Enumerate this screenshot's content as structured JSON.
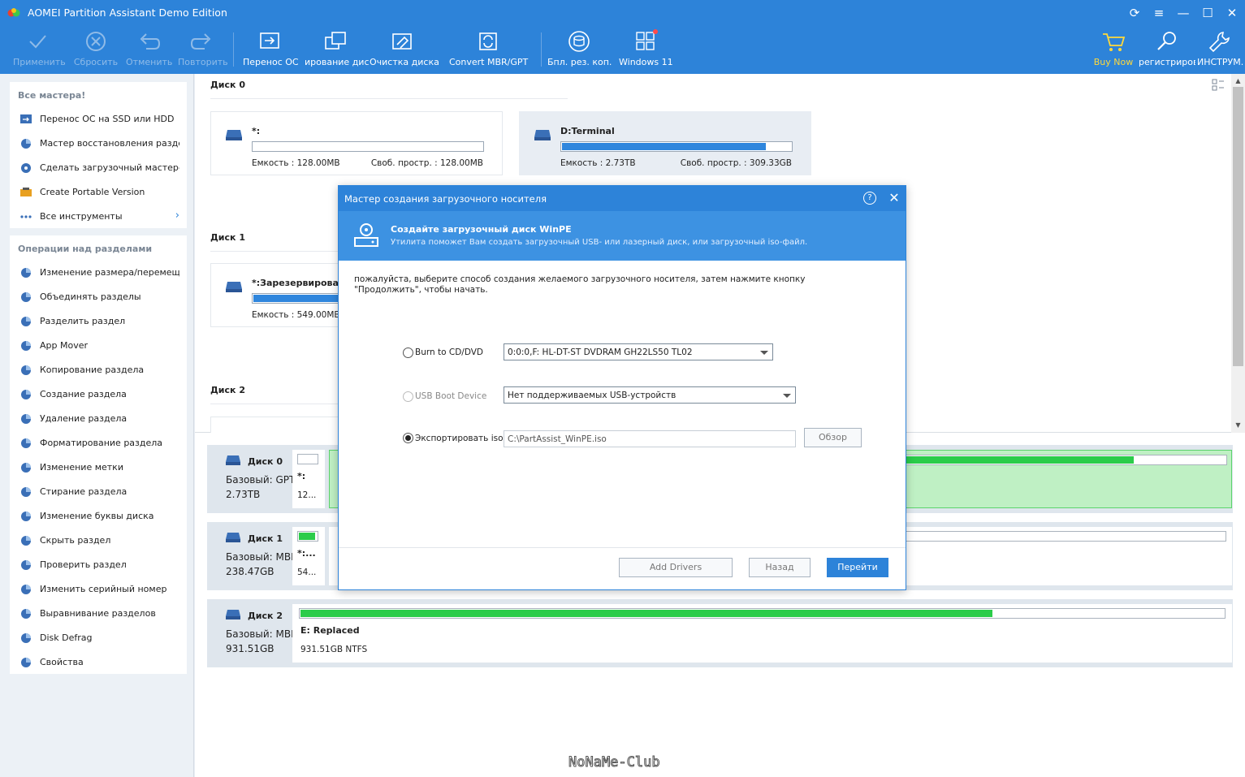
{
  "app": {
    "title": "AOMEI Partition Assistant Demo Edition"
  },
  "toolbar": {
    "apply": "Применить",
    "reset": "Сбросить",
    "undo": "Отменить",
    "redo": "Повторить",
    "migrate_os": "Перенос ОС",
    "clone_disk": "ирование дис",
    "wipe_disk": "Очистка диска",
    "convert": "Convert MBR/GPT",
    "backup": "Бпл. рез. коп.",
    "windows11": "Windows 11",
    "buy_now": "Buy Now",
    "register": "регистрирова",
    "tools": "ИНСТРУМ."
  },
  "sidebar": {
    "wizards_heading": "Все мастера!",
    "wizards": [
      "Перенос ОС на SSD или HDD",
      "Мастер восстановления раздела",
      "Сделать загрузочный мастер-...",
      "Create Portable Version",
      "Все инструменты"
    ],
    "ops_heading": "Операции над разделами",
    "ops": [
      "Изменение размера/перемеще...",
      "Объединять разделы",
      "Разделить раздел",
      "App Mover",
      "Копирование раздела",
      "Создание раздела",
      "Удаление раздела",
      "Форматирование раздела",
      "Изменение метки",
      "Стирание раздела",
      "Изменение буквы диска",
      "Скрыть раздел",
      "Проверить раздел",
      "Изменить серийный номер",
      "Выравнивание разделов",
      "Disk Defrag",
      "Свойства"
    ]
  },
  "upper": {
    "disk0_title": "Диск 0",
    "disk1_title": "Диск 1",
    "disk2_title": "Диск 2",
    "p0a": {
      "name": "*:",
      "cap": "Емкость : 128.00MB",
      "free": "Своб. простр. : 128.00MB",
      "used_fraction": 0.0
    },
    "p0b": {
      "name": "D:Terminal",
      "cap": "Емкость : 2.73TB",
      "free": "Своб. простр. : 309.33GB",
      "used_fraction": 0.89
    },
    "p1a": {
      "name": "*:Зарезервирован",
      "cap": "Емкость : 549.00MB",
      "used_fraction": 0.8
    }
  },
  "map": {
    "d0": {
      "name": "Диск 0",
      "type": "Базовый: GPT",
      "size": "2.73TB",
      "cell_name": "*:",
      "cell_size": "12...",
      "right_used_fraction": 0.72
    },
    "d1": {
      "name": "Диск 1",
      "type": "Базовый: MBR",
      "size": "238.47GB",
      "cell_name": "*:...",
      "cell_size": "54..."
    },
    "d2": {
      "name": "Диск 2",
      "type": "Базовый: MBR",
      "size": "931.51GB",
      "cell_name": "E: Replaced",
      "cell_size": "931.51GB NTFS",
      "used_fraction": 0.75
    }
  },
  "dialog": {
    "title": "Мастер создания загрузочного носителя",
    "help": "?",
    "banner_title": "Создайте загрузочный диск WinPE",
    "banner_sub": "Утилита поможет Вам создать загрузочный USB- или лазерный диск, или загрузочный iso-файл.",
    "instructions": "пожалуйста, выберите способ создания желаемого загрузочного носителя, затем нажмите кнопку \"Продолжить\", чтобы начать.",
    "opt_cd": "Burn to CD/DVD",
    "cd_value": "0:0:0,F: HL-DT-ST DVDRAM GH22LS50  TL02",
    "opt_usb": "USB Boot Device",
    "usb_value": "Нет поддерживаемых USB-устройств",
    "opt_iso": "Экспортировать iso-",
    "iso_path": "C:\\PartAssist_WinPE.iso",
    "browse": "Обзор",
    "add_drivers": "Add Drivers",
    "back": "Назад",
    "next": "Перейти",
    "selected_option": "iso"
  },
  "watermark": "NoNaMe-Club",
  "colors": {
    "accent": "#2d83d9",
    "bar_blue": "#2f86dd",
    "bar_green": "#2bcc4a",
    "buy_now": "#ffd93b"
  }
}
